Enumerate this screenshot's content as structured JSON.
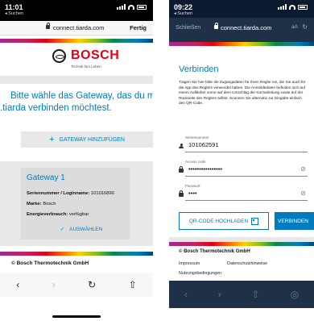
{
  "left": {
    "status": {
      "time": "11:01",
      "back_app": "◂ Suchen"
    },
    "url": "connect.tiarda.com",
    "done": "Fertig",
    "brand": {
      "name": "BOSCH",
      "tagline": "Technik fürs Leben"
    },
    "heading_l1": "Bitte wähle das Gateway, das du mit",
    "heading_l2": ".tiarda verbinden möchtest.",
    "add_gateway": "GATEWAY HINZUFÜGEN",
    "card": {
      "title": "Gateway 1",
      "serial_label": "Seriennummer / Loginname:",
      "serial_value": "101016890",
      "brand_label": "Marke:",
      "brand_value": "Bosch",
      "energy_label": "Energieverbrauch:",
      "energy_value": "verfügbar",
      "select": "AUSWÄHLEN"
    },
    "footer": "© Bosch Thermotechnik GmbH",
    "toolbar": {
      "back": "‹",
      "forward": "›",
      "reload": "↻",
      "share": "⇧"
    }
  },
  "right": {
    "status": {
      "time": "09:22",
      "back_app": "◂ Suchen"
    },
    "close": "Schließen",
    "url": "connect.tiarda.com",
    "aa": "aA",
    "reload": "↻",
    "title": "Verbinden",
    "description": "Tragen Sie hier bitte die Zugangsdaten für Ihren Regler ein, die Sie auch für die App des Reglers verwendet haben. Die Anmeldedaten befinden sich auf einem Aufkleber vorne auf dem Umschlag der Kurzanleitung sowie auf der Rückseite des Reglers selbst. Scannen Sie alternativ zur Eingabe einfach den QR-Code.",
    "fields": [
      {
        "label": "Seriennummer",
        "value": "101062591",
        "icon": "user-icon"
      },
      {
        "label": "Access code",
        "value": "••••••••••••••••",
        "icon": "lock-icon"
      },
      {
        "label": "Passwort",
        "value": "••••",
        "icon": "lock-icon"
      }
    ],
    "qr_button": "QR-CODE HOCHLADEN",
    "connect_button": "VERBINDEN",
    "footer_brand": "© Bosch Thermotechnik GmbH",
    "links": {
      "imprint": "Impressum",
      "privacy": "Datenschutzhinweise",
      "terms": "Nutzungsbedingungen"
    },
    "toolbar": {
      "back": "‹",
      "forward": "›",
      "share": "⇧",
      "compass": "◎"
    }
  }
}
